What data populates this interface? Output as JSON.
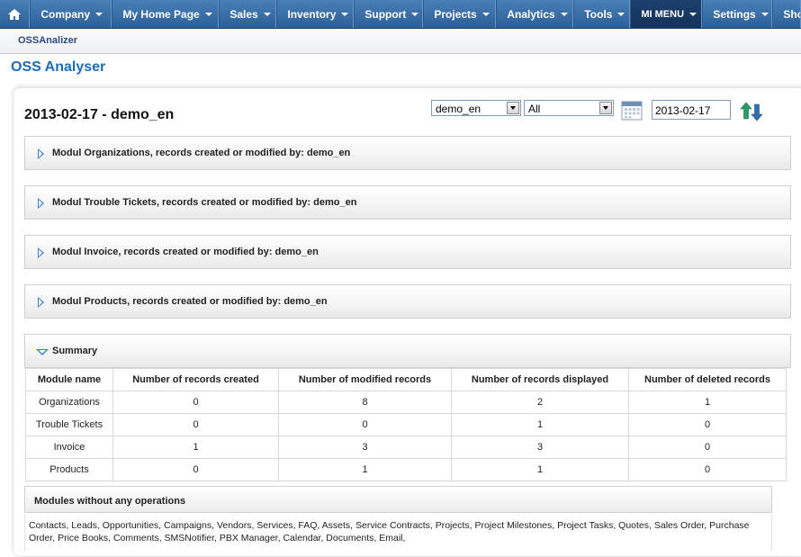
{
  "nav": {
    "items": [
      {
        "label": "Company"
      },
      {
        "label": "My Home Page"
      },
      {
        "label": "Sales"
      },
      {
        "label": "Inventory"
      },
      {
        "label": "Support"
      },
      {
        "label": "Projects"
      },
      {
        "label": "Analytics"
      },
      {
        "label": "Tools"
      },
      {
        "label": "MI MENU"
      },
      {
        "label": "Settings"
      },
      {
        "label": "Sho"
      }
    ]
  },
  "subnav": {
    "link": "OSSAnalizer"
  },
  "page": {
    "title": "OSS Analyser"
  },
  "report": {
    "heading": "2013-02-17 - demo_en",
    "user_select": "demo_en",
    "filter_select": "All",
    "date": "2013-02-17"
  },
  "modules": [
    {
      "label": "Modul Organizations, records created or modified by: demo_en"
    },
    {
      "label": "Modul Trouble Tickets, records created or modified by: demo_en"
    },
    {
      "label": "Modul Invoice, records created or modified by: demo_en"
    },
    {
      "label": "Modul Products, records created or modified by: demo_en"
    }
  ],
  "summary": {
    "label": "Summary",
    "headers": [
      "Module name",
      "Number of records created",
      "Number of modified records",
      "Number of records displayed",
      "Number of deleted records"
    ],
    "rows": [
      [
        "Organizations",
        "0",
        "8",
        "2",
        "1"
      ],
      [
        "Trouble Tickets",
        "0",
        "0",
        "1",
        "0"
      ],
      [
        "Invoice",
        "1",
        "3",
        "3",
        "0"
      ],
      [
        "Products",
        "0",
        "1",
        "1",
        "0"
      ]
    ]
  },
  "no_ops": {
    "label": "Modules without any operations",
    "text": "Contacts, Leads, Opportunities, Campaigns, Vendors, Services, FAQ, Assets, Service Contracts, Projects, Project Milestones, Project Tasks, Quotes, Sales Order, Purchase Order, Price Books, Comments, SMSNotifier, PBX Manager, Calendar, Documents, Email,"
  }
}
